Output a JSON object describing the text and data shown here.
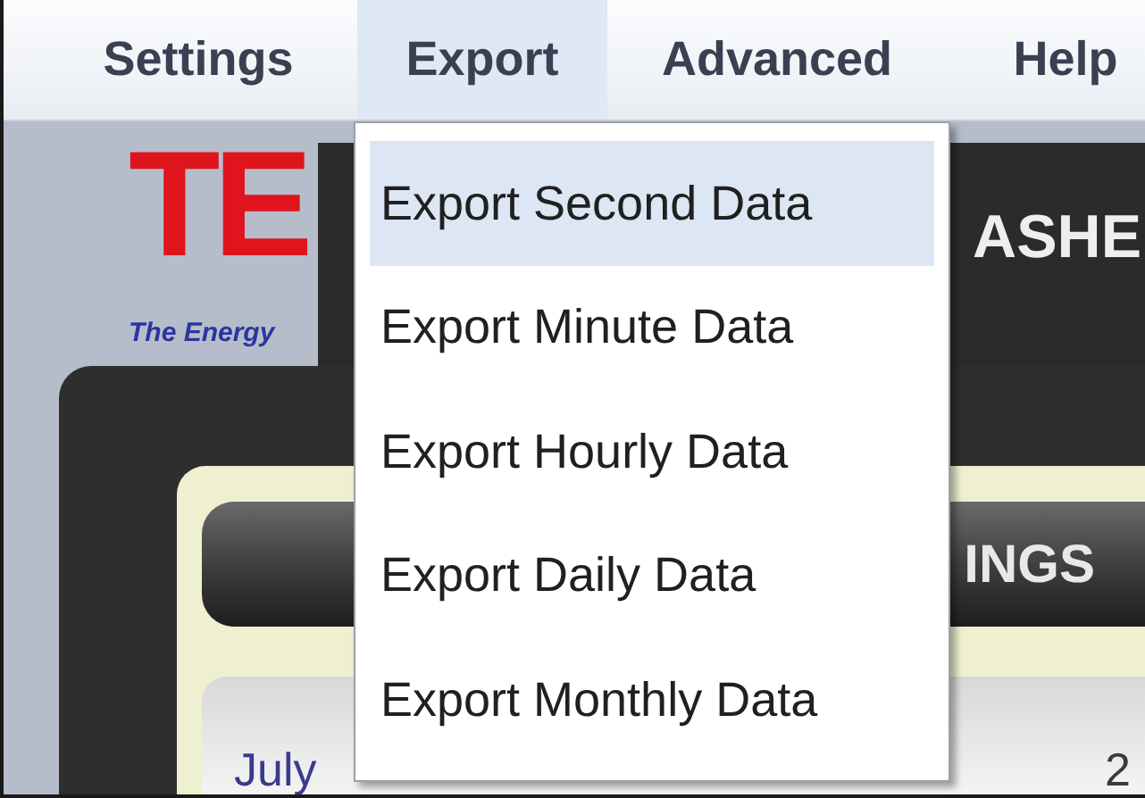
{
  "menu_bar": [
    {
      "label": "Settings",
      "selected": false
    },
    {
      "label": "Export",
      "selected": true
    },
    {
      "label": "Advanced",
      "selected": false
    },
    {
      "label": "Help",
      "selected": false
    }
  ],
  "export_menu": [
    {
      "label": "Export Second Data",
      "selected": true
    },
    {
      "label": "Export Minute Data",
      "selected": false
    },
    {
      "label": "Export Hourly Data",
      "selected": false
    },
    {
      "label": "Export Daily Data",
      "selected": false
    },
    {
      "label": "Export Monthly Data",
      "selected": false
    }
  ],
  "logo": {
    "letters": "TE",
    "tagline": "The Energy"
  },
  "header": {
    "title": "ASHE"
  },
  "panel": {
    "button": "INGS",
    "month": "July",
    "value": "2"
  }
}
